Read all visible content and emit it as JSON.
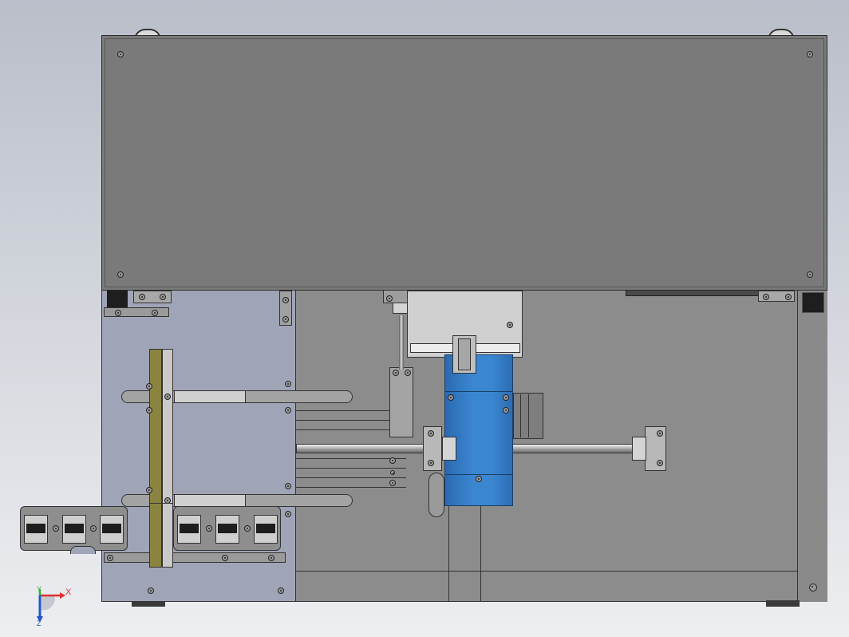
{
  "viewport": {
    "background_top": "#b9bec9",
    "background_bottom": "#eceef1"
  },
  "colors": {
    "top_cover": "#7a7a7a",
    "frame": "#8c8c8c",
    "left_panel": "#9fa5b6",
    "motor_blue": "#3b82c8",
    "olive_bar": "#8a8440",
    "dark_block": "#1e1e1e"
  },
  "triad": {
    "x_label": "X",
    "y_label": "Y",
    "z_label": "Z",
    "x_color": "#e03030",
    "y_color": "#2fb02f",
    "z_color": "#2255cc"
  }
}
